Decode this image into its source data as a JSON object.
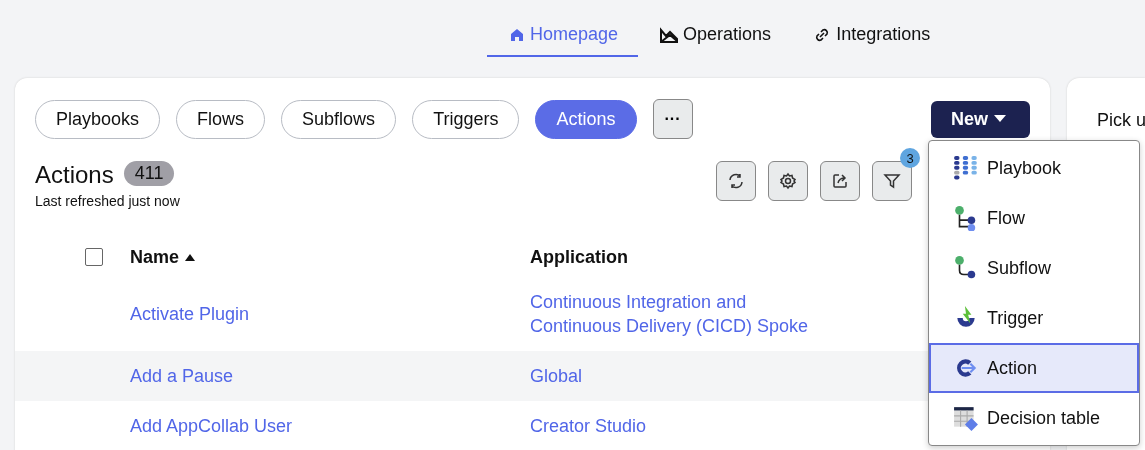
{
  "nav_tabs": [
    {
      "label": "Homepage",
      "kind": "home",
      "selected": true
    },
    {
      "label": "Operations",
      "kind": "chart",
      "selected": false
    },
    {
      "label": "Integrations",
      "kind": "link",
      "selected": false
    }
  ],
  "filters": [
    {
      "label": "Playbooks",
      "selected": false
    },
    {
      "label": "Flows",
      "selected": false
    },
    {
      "label": "Subflows",
      "selected": false
    },
    {
      "label": "Triggers",
      "selected": false
    },
    {
      "label": "Actions",
      "selected": true
    }
  ],
  "more_button": "···",
  "new_button": "New",
  "title": "Actions",
  "count": "411",
  "refreshed": "Last refreshed just now",
  "toolbar": [
    {
      "kind": "refresh"
    },
    {
      "kind": "settings"
    },
    {
      "kind": "export"
    },
    {
      "kind": "filter",
      "badge": "3"
    }
  ],
  "table": {
    "select_all": {
      "checked": false
    },
    "columns": [
      "Name",
      "Application"
    ],
    "rows": [
      {
        "name": "Activate Plugin",
        "application": "Continuous Integration and Continuous Delivery (CICD) Spoke"
      },
      {
        "name": "Add a Pause",
        "application": "Global"
      },
      {
        "name": "Add AppCollab User",
        "application": "Creator Studio"
      }
    ]
  },
  "new_menu": [
    {
      "label": "Playbook",
      "kind": "playbook",
      "selected": false
    },
    {
      "label": "Flow",
      "kind": "flow",
      "selected": false
    },
    {
      "label": "Subflow",
      "kind": "subflow",
      "selected": false
    },
    {
      "label": "Trigger",
      "kind": "trigger",
      "selected": false
    },
    {
      "label": "Action",
      "kind": "action",
      "selected": true
    },
    {
      "label": "Decision table",
      "kind": "decision",
      "selected": false
    }
  ],
  "side_panel": {
    "text": "Pick u"
  }
}
